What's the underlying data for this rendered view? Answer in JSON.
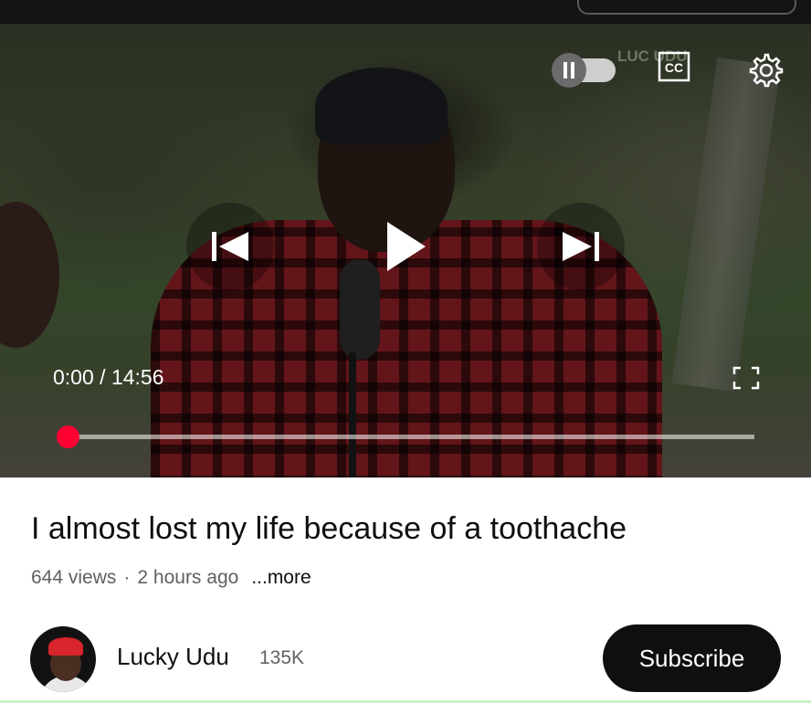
{
  "player": {
    "current_time": "0:00",
    "separator": "/",
    "duration": "14:56",
    "progress_fraction": 0.0,
    "watermark": "LUC   UDU",
    "accent_color": "#ff0033",
    "icons": {
      "autoplay": "pause-icon",
      "captions": "cc-icon",
      "settings": "gear-icon",
      "previous": "skip-previous-icon",
      "play": "play-icon",
      "next": "skip-next-icon",
      "fullscreen": "fullscreen-icon"
    }
  },
  "video": {
    "title": "I almost lost my life because of a toothache",
    "views": "644 views",
    "separator": "·",
    "age": "2 hours ago",
    "more_label": "...more"
  },
  "channel": {
    "name": "Lucky Udu",
    "subscribers": "135K",
    "subscribe_label": "Subscribe"
  }
}
